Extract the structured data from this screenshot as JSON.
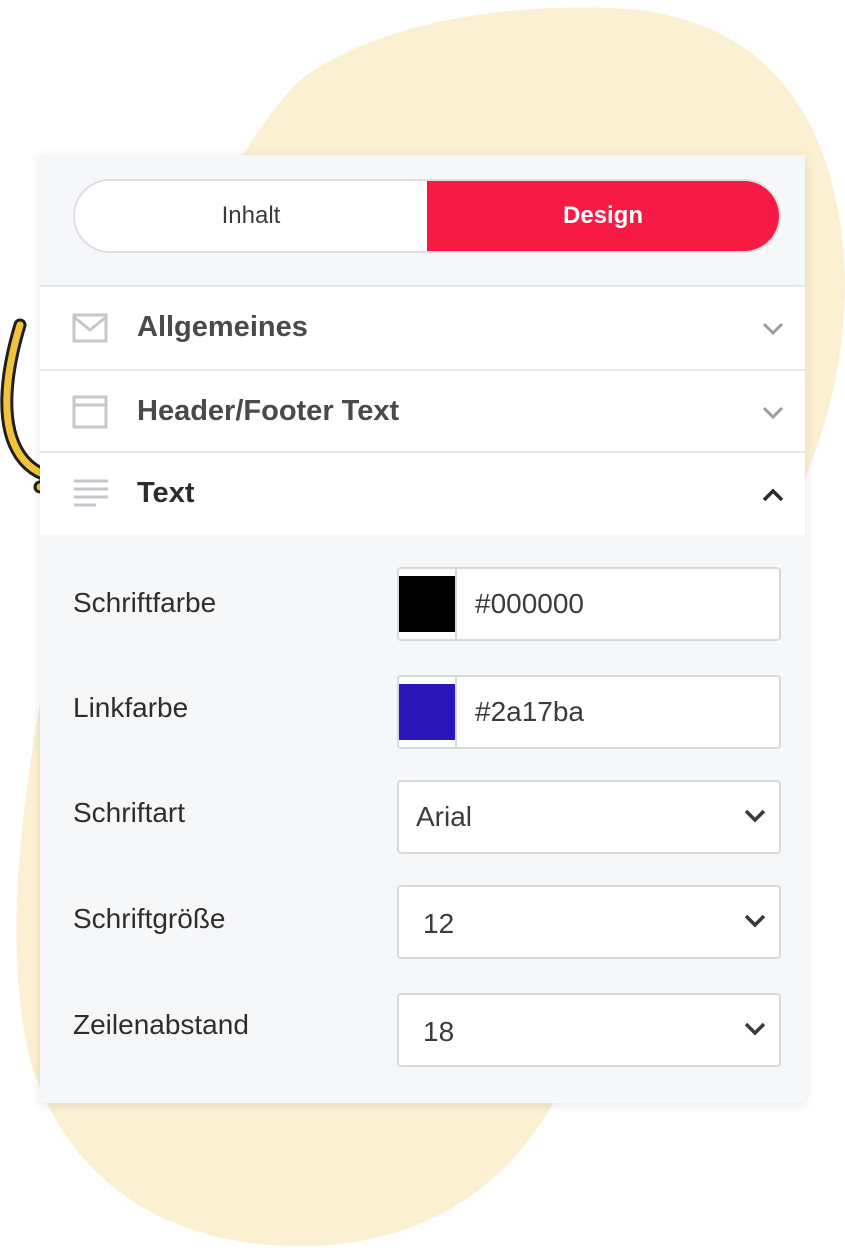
{
  "tabs": [
    {
      "label": "Inhalt",
      "active": false
    },
    {
      "label": "Design",
      "active": true
    }
  ],
  "sections": [
    {
      "label": "Allgemeines",
      "icon": "mail-icon",
      "expanded": false
    },
    {
      "label": "Header/Footer Text",
      "icon": "window-icon",
      "expanded": false
    },
    {
      "label": "Text",
      "icon": "text-lines-icon",
      "expanded": true
    }
  ],
  "text_settings": {
    "font_color": {
      "label": "Schriftfarbe",
      "value": "#000000",
      "swatch": "#000000"
    },
    "link_color": {
      "label": "Linkfarbe",
      "value": "#2a17ba",
      "swatch": "#2a17ba"
    },
    "font_family": {
      "label": "Schriftart",
      "value": "Arial"
    },
    "font_size": {
      "label": "Schriftgröße",
      "value": "12"
    },
    "line_height": {
      "label": "Zeilenabstand",
      "value": "18"
    }
  },
  "colors": {
    "accent": "#f61a45",
    "blob": "#fcf0d2",
    "arrow": "#f2c33a"
  }
}
